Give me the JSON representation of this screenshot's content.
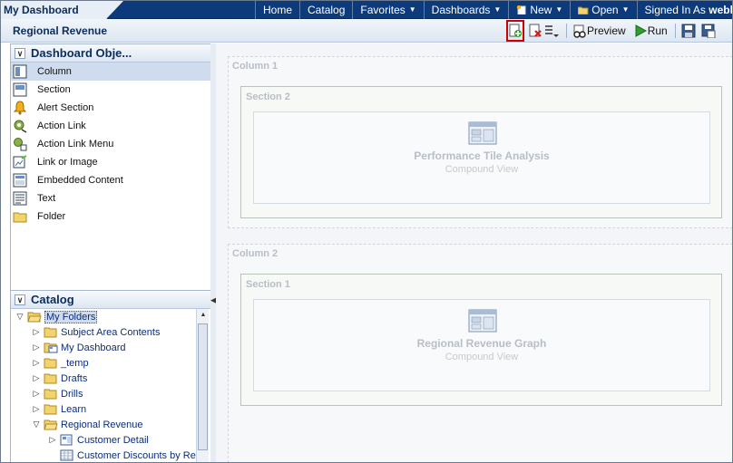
{
  "header": {
    "dashboard_tab": "My Dashboard",
    "nav": {
      "home": "Home",
      "catalog": "Catalog",
      "favorites": "Favorites",
      "dashboards": "Dashboards",
      "new": "New",
      "open": "Open",
      "signed_in_as": "Signed In As",
      "user": "weblo"
    }
  },
  "subbar": {
    "page_title": "Regional Revenue",
    "preview_label": "Preview",
    "run_label": "Run"
  },
  "dashboard_objects": {
    "title": "Dashboard Obje...",
    "items": [
      {
        "label": "Column",
        "icon": "column-icon"
      },
      {
        "label": "Section",
        "icon": "section-icon"
      },
      {
        "label": "Alert Section",
        "icon": "alert-bell-icon"
      },
      {
        "label": "Action Link",
        "icon": "action-link-icon"
      },
      {
        "label": "Action Link Menu",
        "icon": "action-link-menu-icon"
      },
      {
        "label": "Link or Image",
        "icon": "link-image-icon"
      },
      {
        "label": "Embedded Content",
        "icon": "embedded-content-icon"
      },
      {
        "label": "Text",
        "icon": "text-icon"
      },
      {
        "label": "Folder",
        "icon": "folder-icon"
      }
    ]
  },
  "catalog": {
    "title": "Catalog",
    "items": [
      {
        "label": "My Folders",
        "toggle": "▽",
        "icon": "open-folder-icon"
      },
      {
        "label": "Subject Area Contents",
        "toggle": "▷",
        "icon": "folder-icon"
      },
      {
        "label": "My Dashboard",
        "toggle": "▷",
        "icon": "dashboard-folder-icon"
      },
      {
        "label": "_temp",
        "toggle": "▷",
        "icon": "folder-icon"
      },
      {
        "label": "Drafts",
        "toggle": "▷",
        "icon": "folder-icon"
      },
      {
        "label": "Drills",
        "toggle": "▷",
        "icon": "folder-icon"
      },
      {
        "label": "Learn",
        "toggle": "▷",
        "icon": "folder-icon"
      },
      {
        "label": "Regional Revenue",
        "toggle": "▽",
        "icon": "open-folder-icon"
      },
      {
        "label": "Customer Detail",
        "toggle": "▷",
        "icon": "dashboard-page-icon"
      },
      {
        "label": "Customer Discounts by Re",
        "toggle": "",
        "icon": "analysis-icon"
      }
    ]
  },
  "layout": {
    "columns": [
      {
        "title": "Column 1",
        "section": {
          "title": "Section 2",
          "view": {
            "name": "Performance Tile Analysis",
            "type": "Compound View"
          }
        }
      },
      {
        "title": "Column 2",
        "section": {
          "title": "Section 1",
          "view": {
            "name": "Regional Revenue Graph",
            "type": "Compound View"
          }
        }
      }
    ]
  }
}
